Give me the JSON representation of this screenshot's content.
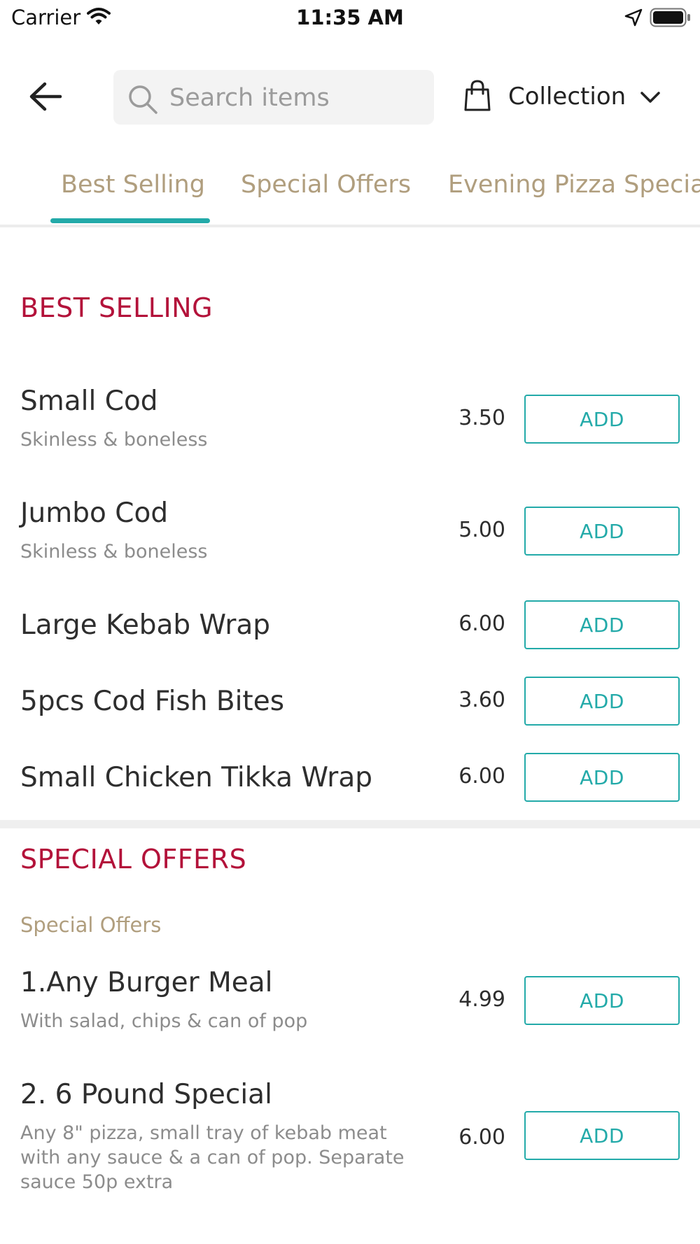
{
  "status_bar": {
    "carrier": "Carrier",
    "time": "11:35 AM"
  },
  "header": {
    "back_icon": "arrow-left-icon",
    "search": {
      "placeholder": "Search items",
      "value": "",
      "icon": "search-icon"
    },
    "order_mode": {
      "label": "Collection",
      "icon": "shopping-bag-icon",
      "dropdown_icon": "chevron-down-icon"
    }
  },
  "tabs": [
    {
      "label": "Best Selling",
      "active": true
    },
    {
      "label": "Special Offers",
      "active": false
    },
    {
      "label": "Evening Pizza Specia",
      "active": false
    }
  ],
  "colors": {
    "accent": "#23aaa9",
    "section_title": "#b3123a",
    "tab_text": "#b09e7e"
  },
  "sections": {
    "best_selling": {
      "title": "BEST SELLING",
      "items": [
        {
          "name": "Small Cod",
          "description": "Skinless & boneless",
          "price": "3.50",
          "button": "ADD"
        },
        {
          "name": "Jumbo Cod",
          "description": "Skinless & boneless",
          "price": "5.00",
          "button": "ADD"
        },
        {
          "name": "Large Kebab Wrap",
          "description": "",
          "price": "6.00",
          "button": "ADD"
        },
        {
          "name": "5pcs Cod Fish Bites",
          "description": "",
          "price": "3.60",
          "button": "ADD"
        },
        {
          "name": "Small Chicken Tikka Wrap",
          "description": "",
          "price": "6.00",
          "button": "ADD"
        }
      ]
    },
    "special_offers": {
      "title": "SPECIAL OFFERS",
      "subheading": "Special Offers",
      "items": [
        {
          "name": "1.Any Burger Meal",
          "description": "With salad, chips & can of pop",
          "price": "4.99",
          "button": "ADD"
        },
        {
          "name": "2. 6 Pound Special",
          "description": "Any 8\" pizza, small tray of kebab meat with any sauce & a can of pop. Separate sauce 50p extra",
          "price": "6.00",
          "button": "ADD"
        }
      ]
    }
  }
}
